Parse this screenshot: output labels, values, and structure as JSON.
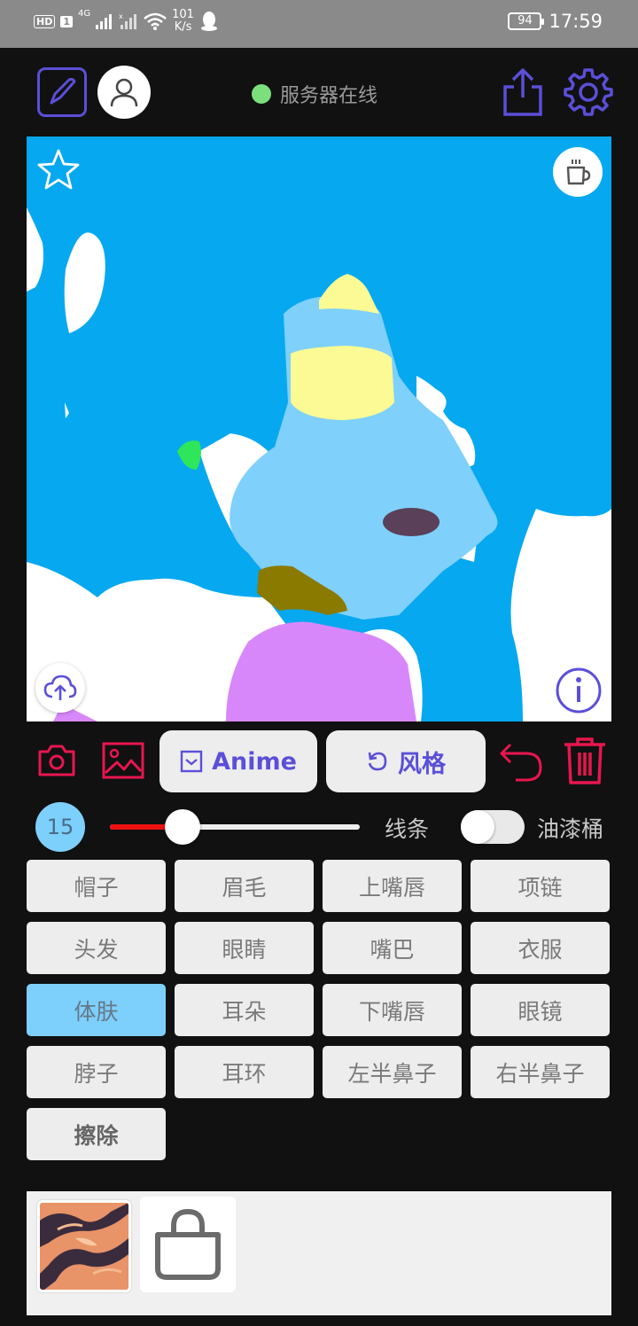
{
  "status_bar": {
    "hd": "HD",
    "sim": "1",
    "network": "4G",
    "speed_value": "101",
    "speed_unit": "K/s",
    "battery": "94",
    "time": "17:59"
  },
  "header": {
    "server_status": "服务器在线",
    "server_status_color": "#7be07b"
  },
  "canvas": {
    "background_color": "#06a8f0"
  },
  "toolbar": {
    "anime_label": "Anime",
    "style_label": "风格",
    "accent_color": "#5b4fd8",
    "danger_color": "#e8164e"
  },
  "brush": {
    "size": "15",
    "slider_fraction": 0.29,
    "line_label": "线条",
    "bucket_label": "油漆桶",
    "bucket_enabled": false
  },
  "parts": [
    {
      "label": "帽子",
      "selected": false
    },
    {
      "label": "眉毛",
      "selected": false
    },
    {
      "label": "上嘴唇",
      "selected": false
    },
    {
      "label": "项链",
      "selected": false
    },
    {
      "label": "头发",
      "selected": false
    },
    {
      "label": "眼睛",
      "selected": false
    },
    {
      "label": "嘴巴",
      "selected": false
    },
    {
      "label": "衣服",
      "selected": false
    },
    {
      "label": "体肤",
      "selected": true
    },
    {
      "label": "耳朵",
      "selected": false
    },
    {
      "label": "下嘴唇",
      "selected": false
    },
    {
      "label": "眼镜",
      "selected": false
    },
    {
      "label": "脖子",
      "selected": false
    },
    {
      "label": "耳环",
      "selected": false
    },
    {
      "label": "左半鼻子",
      "selected": false
    },
    {
      "label": "右半鼻子",
      "selected": false
    },
    {
      "label": "擦除",
      "selected": false
    }
  ],
  "icons": {
    "edit": "edit-icon",
    "user": "user-icon",
    "share": "share-icon",
    "settings": "gear-icon",
    "favorite": "star-icon",
    "coffee": "coffee-icon",
    "upload": "cloud-upload-icon",
    "info": "info-icon",
    "camera": "camera-icon",
    "gallery": "image-icon",
    "undo": "undo-icon",
    "delete": "trash-icon",
    "shop": "shopping-bag-icon"
  }
}
